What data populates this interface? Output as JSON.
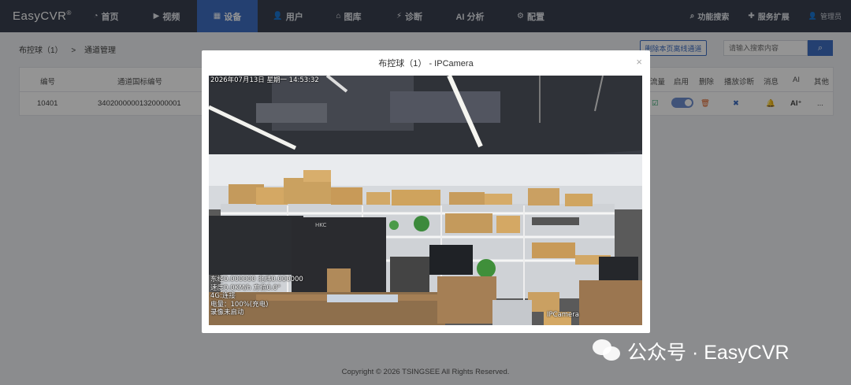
{
  "app": {
    "brand": "EasyCVR",
    "brand_mark": "®"
  },
  "nav": [
    {
      "icon": "dashboard-icon",
      "glyph": "◔",
      "label": "首页"
    },
    {
      "icon": "video-icon",
      "glyph": "▶",
      "label": "视频"
    },
    {
      "icon": "device-icon",
      "glyph": "▦",
      "label": "设备",
      "active": true
    },
    {
      "icon": "user-icon",
      "glyph": "👤",
      "label": "用户"
    },
    {
      "icon": "library-icon",
      "glyph": "⌂",
      "label": "图库"
    },
    {
      "icon": "diagnose-icon",
      "glyph": "⚡",
      "label": "诊断"
    },
    {
      "icon": "ai-icon",
      "glyph": "",
      "label": "AI 分析"
    },
    {
      "icon": "gear-icon",
      "glyph": "⚙",
      "label": "配置"
    }
  ],
  "top_right": {
    "search_feature": "功能搜索",
    "service_ext": "服务扩展",
    "admin": "管理员"
  },
  "breadcrumb": {
    "parent": "布控球（1）",
    "sep": ">",
    "current": "通道管理"
  },
  "toolbar": {
    "clear_offline": "删除本页离线通道",
    "search_placeholder": "请输入搜索内容"
  },
  "table": {
    "headers": {
      "id": "编号",
      "gb_id": "通道国标编号",
      "stream": "流量",
      "enable": "启用",
      "delete": "删除",
      "diag": "播放诊断",
      "msg": "消息",
      "ai": "AI",
      "other": "其他"
    },
    "row": {
      "id": "10401",
      "gb_id": "34020000001320000001",
      "ai": "AI⁺",
      "other": "..."
    }
  },
  "modal": {
    "title": "布控球（1）  - IPCamera",
    "close": "×",
    "osd_time": "2026年07月13日  星期一  14:53:32",
    "osd_lines": [
      "东经0.000000 北纬0.000000",
      "速度0.0KM/h 方位0.0°",
      "4G:连接",
      "电量：100%(充电)",
      "录像未启动"
    ],
    "osd_camera": "IPCamera"
  },
  "footer": "Copyright © 2026 TSINGSEE All Rights Reserved.",
  "watermark": {
    "text": "公众号 · EasyCVR"
  }
}
